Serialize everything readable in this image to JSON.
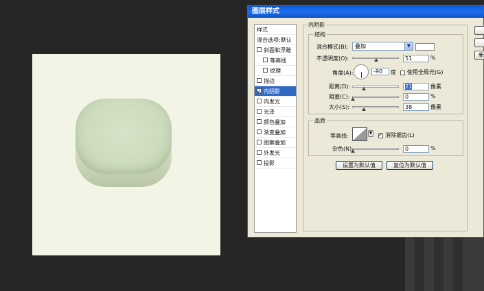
{
  "dialog": {
    "title": "图层样式"
  },
  "styles_list": {
    "items": [
      {
        "label": "样式",
        "checkbox": false,
        "checked": false,
        "indent": false,
        "selected": false
      },
      {
        "label": "混合选项:默认",
        "checkbox": false,
        "checked": false,
        "indent": false,
        "selected": false
      },
      {
        "label": "斜面和浮雕",
        "checkbox": true,
        "checked": false,
        "indent": false,
        "selected": false
      },
      {
        "label": "等高线",
        "checkbox": true,
        "checked": false,
        "indent": true,
        "selected": false
      },
      {
        "label": "纹理",
        "checkbox": true,
        "checked": false,
        "indent": true,
        "selected": false
      },
      {
        "label": "描边",
        "checkbox": true,
        "checked": false,
        "indent": false,
        "selected": false
      },
      {
        "label": "内阴影",
        "checkbox": true,
        "checked": true,
        "indent": false,
        "selected": true
      },
      {
        "label": "内发光",
        "checkbox": true,
        "checked": false,
        "indent": false,
        "selected": false
      },
      {
        "label": "光泽",
        "checkbox": true,
        "checked": false,
        "indent": false,
        "selected": false
      },
      {
        "label": "颜色叠加",
        "checkbox": true,
        "checked": false,
        "indent": false,
        "selected": false
      },
      {
        "label": "渐变叠加",
        "checkbox": true,
        "checked": false,
        "indent": false,
        "selected": false
      },
      {
        "label": "图案叠加",
        "checkbox": true,
        "checked": false,
        "indent": false,
        "selected": false
      },
      {
        "label": "外发光",
        "checkbox": true,
        "checked": false,
        "indent": false,
        "selected": false
      },
      {
        "label": "投影",
        "checkbox": true,
        "checked": false,
        "indent": false,
        "selected": false
      }
    ]
  },
  "inner_shadow": {
    "section_title": "内阴影",
    "structure_title": "结构",
    "blend_mode_label": "混合模式(B):",
    "blend_mode_value": "叠加",
    "shadow_color": "#ffffff",
    "opacity_label": "不透明度(O):",
    "opacity_value": "51",
    "opacity_unit": "%",
    "opacity_level": 0.51,
    "angle_label": "角度(A):",
    "angle_value": "-90",
    "angle_unit": "度",
    "global_light_label": "使用全局光(G)",
    "global_light_checked": false,
    "distance_label": "距离(D):",
    "distance_value": "21",
    "distance_unit": "像素",
    "choke_label": "阻塞(C):",
    "choke_value": "0",
    "choke_unit": "%",
    "size_label": "大小(S):",
    "size_value": "38",
    "size_unit": "像素",
    "quality_title": "品质",
    "contour_label": "等高线:",
    "anti_alias_label": "消除锯齿(L)",
    "anti_alias_checked": true,
    "noise_label": "杂色(N):",
    "noise_value": "0",
    "noise_unit": "%",
    "set_default_label": "设置为默认值",
    "reset_default_label": "复位为默认值"
  },
  "side_buttons": {
    "new_label": "新"
  },
  "colors": {
    "canvas": "#f2f5e6",
    "shape": "#cddcbf",
    "selection": "#316ac5",
    "titlebar": "#1d6df0"
  }
}
